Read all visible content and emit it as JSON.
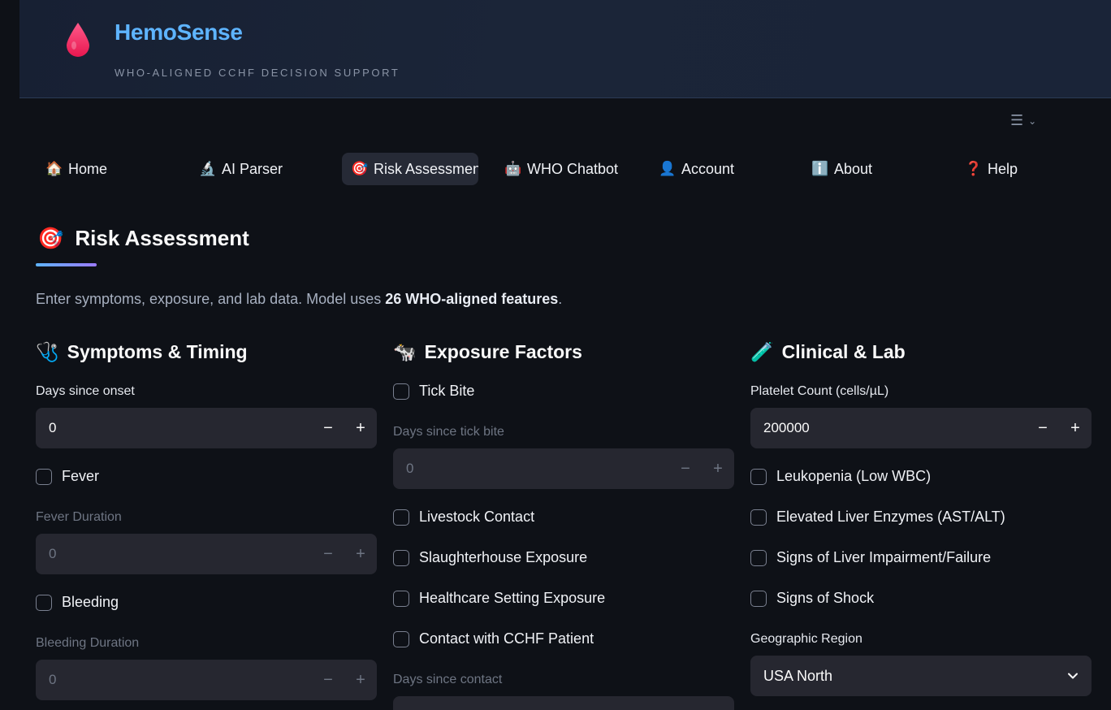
{
  "brand": {
    "title": "HemoSense",
    "subtitle": "WHO-ALIGNED CCHF DECISION SUPPORT",
    "logo_icon": "blood-drop-icon",
    "accent": "#5eb4ff",
    "logo_color": "#ff2d6a"
  },
  "menu_toggle": {
    "icon": "☰",
    "chevron": "⌄"
  },
  "nav": [
    {
      "label": "Home",
      "icon": "🏠"
    },
    {
      "label": "AI Parser",
      "icon": "🔬"
    },
    {
      "label": "Risk Assessment",
      "icon": "🎯"
    },
    {
      "label": "WHO Chatbot",
      "icon": "🤖"
    },
    {
      "label": "Account",
      "icon": "👤"
    },
    {
      "label": "About",
      "icon": "ℹ️"
    },
    {
      "label": "Help",
      "icon": "❓"
    }
  ],
  "page": {
    "title": "Risk Assessment",
    "title_icon": "🎯",
    "intro_prefix": "Enter symptoms, exposure, and lab data. Model uses ",
    "intro_bold": "26 WHO-aligned features",
    "intro_suffix": "."
  },
  "symptoms": {
    "heading": "Symptoms & Timing",
    "icon": "🩺",
    "days_label": "Days since onset",
    "days_value": "0",
    "fever_label": "Fever",
    "fever_duration_label": "Fever Duration",
    "fever_duration_value": "0",
    "bleeding_label": "Bleeding",
    "bleeding_duration_label": "Bleeding Duration",
    "bleeding_duration_value": "0"
  },
  "exposure": {
    "heading": "Exposure Factors",
    "icon": "🐄",
    "tick_bite_label": "Tick Bite",
    "days_tick_label": "Days since tick bite",
    "days_tick_value": "0",
    "livestock_label": "Livestock Contact",
    "slaughter_label": "Slaughterhouse Exposure",
    "healthcare_label": "Healthcare Setting Exposure",
    "patient_label": "Contact with CCHF Patient",
    "days_contact_label": "Days since contact"
  },
  "clinical": {
    "heading": "Clinical & Lab",
    "icon": "🧪",
    "platelet_label": "Platelet Count (cells/µL)",
    "platelet_value": "200000",
    "leukopenia_label": "Leukopenia (Low WBC)",
    "liver_enzymes_label": "Elevated Liver Enzymes (AST/ALT)",
    "liver_failure_label": "Signs of Liver Impairment/Failure",
    "shock_label": "Signs of Shock",
    "region_label": "Geographic Region",
    "region_value": "USA North"
  },
  "steppers": {
    "minus": "−",
    "plus": "+"
  }
}
